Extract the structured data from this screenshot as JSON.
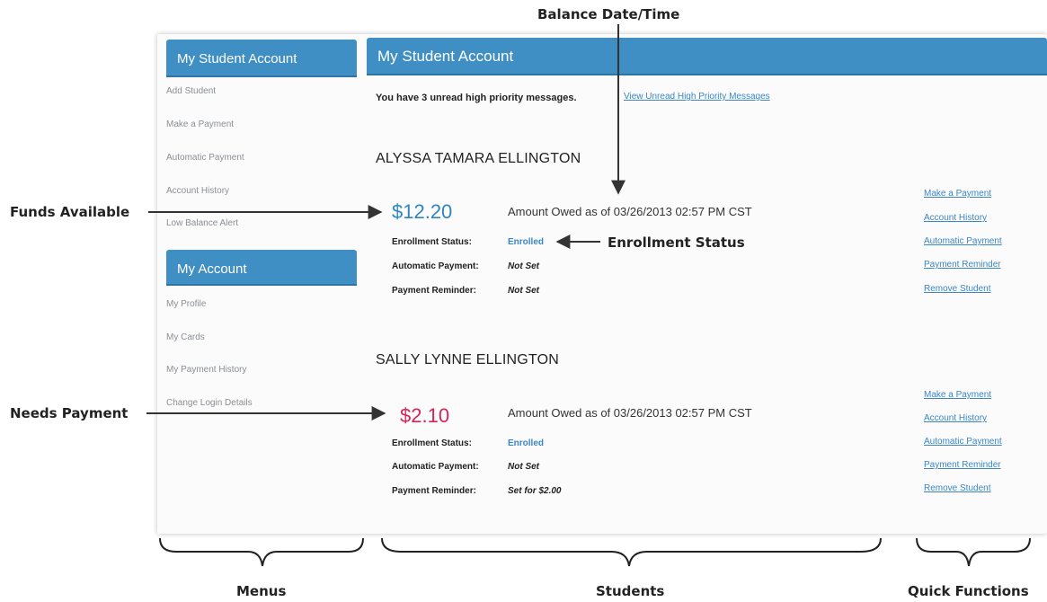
{
  "callouts": {
    "balance_datetime": "Balance Date/Time",
    "funds_available": "Funds Available",
    "enrollment_status": "Enrollment Status",
    "needs_payment": "Needs Payment",
    "menus": "Menus",
    "students": "Students",
    "quick_functions": "Quick Functions"
  },
  "sidebar": {
    "student_section": {
      "title": "My Student Account",
      "items": [
        "Add Student",
        "Make a Payment",
        "Automatic Payment",
        "Account History",
        "Low Balance Alert"
      ]
    },
    "account_section": {
      "title": "My Account",
      "items": [
        "My Profile",
        "My Cards",
        "My Payment History",
        "Change Login Details"
      ]
    }
  },
  "main": {
    "title": "My Student Account",
    "message_text": "You have 3 unread high priority messages.",
    "message_link": "View Unread High Priority Messages",
    "students": [
      {
        "name": "ALYSSA TAMARA ELLINGTON",
        "amount": "$12.20",
        "owed_label": "Amount Owed as of 03/26/2013 02:57 PM CST",
        "enrollment_label": "Enrollment Status:",
        "enrollment_value": "Enrolled",
        "autopay_label": "Automatic Payment:",
        "autopay_value": "Not Set",
        "reminder_label": "Payment Reminder:",
        "reminder_value": "Not Set",
        "amount_status": "funds-available",
        "amount_color": "#2e86c1"
      },
      {
        "name": "SALLY LYNNE ELLINGTON",
        "amount": "$2.10",
        "owed_label": "Amount Owed as of 03/26/2013 02:57 PM CST",
        "enrollment_label": "Enrollment Status:",
        "enrollment_value": "Enrolled",
        "autopay_label": "Automatic Payment:",
        "autopay_value": "Not Set",
        "reminder_label": "Payment Reminder:",
        "reminder_value": "Set for $2.00",
        "amount_status": "needs-payment",
        "amount_color": "#d4245a"
      }
    ]
  },
  "quick_functions": [
    "Make a Payment",
    "Account History",
    "Automatic Payment",
    "Payment Reminder",
    "Remove Student"
  ],
  "colors": {
    "header_blue": "#3f8ec4",
    "link_blue": "#3b86c6",
    "positive_blue": "#2e86c1",
    "due_red": "#d4245a"
  }
}
